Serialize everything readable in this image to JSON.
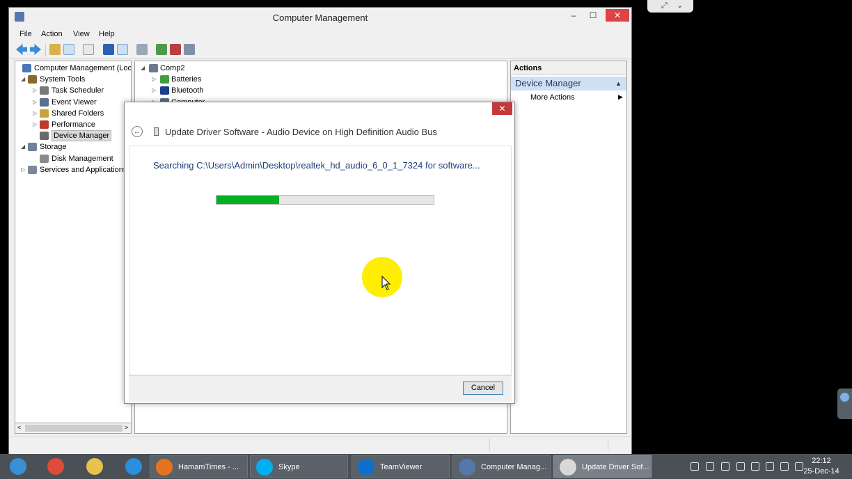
{
  "window": {
    "title": "Computer Management",
    "controls": [
      "–",
      "☐",
      "✕"
    ]
  },
  "menu": [
    "File",
    "Action",
    "View",
    "Help"
  ],
  "tree": [
    {
      "label": "Computer Management (Local",
      "level": 0,
      "expander": "",
      "icon": "computer-management-icon",
      "icon_color": "#4a78b5"
    },
    {
      "label": "System Tools",
      "level": 1,
      "expander": "◢",
      "icon": "tools-icon",
      "icon_color": "#8a6a2a"
    },
    {
      "label": "Task Scheduler",
      "level": 2,
      "expander": "▷",
      "icon": "clock-icon",
      "icon_color": "#7a7a7a"
    },
    {
      "label": "Event Viewer",
      "level": 2,
      "expander": "▷",
      "icon": "event-viewer-icon",
      "icon_color": "#5a6f8a"
    },
    {
      "label": "Shared Folders",
      "level": 2,
      "expander": "▷",
      "icon": "shared-folder-icon",
      "icon_color": "#c9a23c"
    },
    {
      "label": "Performance",
      "level": 2,
      "expander": "▷",
      "icon": "performance-icon",
      "icon_color": "#c0392b"
    },
    {
      "label": "Device Manager",
      "level": 2,
      "expander": "",
      "icon": "device-manager-icon",
      "icon_color": "#6a6a6a",
      "selected": true
    },
    {
      "label": "Storage",
      "level": 1,
      "expander": "◢",
      "icon": "storage-icon",
      "icon_color": "#6f8299"
    },
    {
      "label": "Disk Management",
      "level": 2,
      "expander": "",
      "icon": "disk-icon",
      "icon_color": "#8a8a8a"
    },
    {
      "label": "Services and Applications",
      "level": 1,
      "expander": "▷",
      "icon": "services-icon",
      "icon_color": "#7a8a9a"
    }
  ],
  "devices": [
    {
      "label": "Comp2",
      "level": 0,
      "expander": "◢",
      "icon": "computer-icon",
      "icon_color": "#6a7a8a"
    },
    {
      "label": "Batteries",
      "level": 1,
      "expander": "▷",
      "icon": "battery-icon",
      "icon_color": "#3f9f3f"
    },
    {
      "label": "Bluetooth",
      "level": 1,
      "expander": "▷",
      "icon": "bluetooth-icon",
      "icon_color": "#1a3f8a"
    },
    {
      "label": "Computer",
      "level": 1,
      "expander": "▷",
      "icon": "computer-icon",
      "icon_color": "#5a6f8a"
    }
  ],
  "actions": {
    "header": "Actions",
    "section": "Device Manager",
    "items": [
      "More Actions"
    ]
  },
  "dialog": {
    "title": "Update Driver Software - Audio Device on High Definition Audio Bus",
    "message": "Searching C:\\Users\\Admin\\Desktop\\realtek_hd_audio_6_0_1_7324 for software...",
    "progress": 0.29,
    "cancel_label": "Cancel",
    "close_glyph": "✕",
    "back_glyph": "←"
  },
  "taskbar": {
    "apps": [
      {
        "label": "",
        "icon": "people-icon",
        "color": "#3a8fd6",
        "style": "plain"
      },
      {
        "label": "",
        "icon": "chrome-icon",
        "color": "#dd4b39",
        "style": "plain"
      },
      {
        "label": "",
        "icon": "file-explorer-icon",
        "color": "#e8c24a",
        "style": "plain"
      },
      {
        "label": "",
        "icon": "internet-explorer-icon",
        "color": "#2a8fdc",
        "style": "plain"
      },
      {
        "label": "HamamTimes - ...",
        "icon": "firefox-icon",
        "color": "#e8731f",
        "style": "button"
      },
      {
        "label": "Skype",
        "icon": "skype-icon",
        "color": "#00aff0",
        "style": "button"
      },
      {
        "label": "TeamViewer",
        "icon": "teamviewer-icon",
        "color": "#0e6fcf",
        "style": "button"
      },
      {
        "label": "Computer Manag...",
        "icon": "computer-management-icon",
        "color": "#5577aa",
        "style": "button"
      },
      {
        "label": "Update Driver Sof...",
        "icon": "device-icon",
        "color": "#d8d8d8",
        "style": "active"
      }
    ],
    "tray_icons": [
      "bluetooth-icon",
      "network-sharing-icon",
      "volume-muted-icon",
      "security-icon",
      "notification-icon",
      "flag-icon",
      "network-icon",
      "wifi-icon"
    ],
    "time": "22:12",
    "date": "25-Dec-14"
  }
}
